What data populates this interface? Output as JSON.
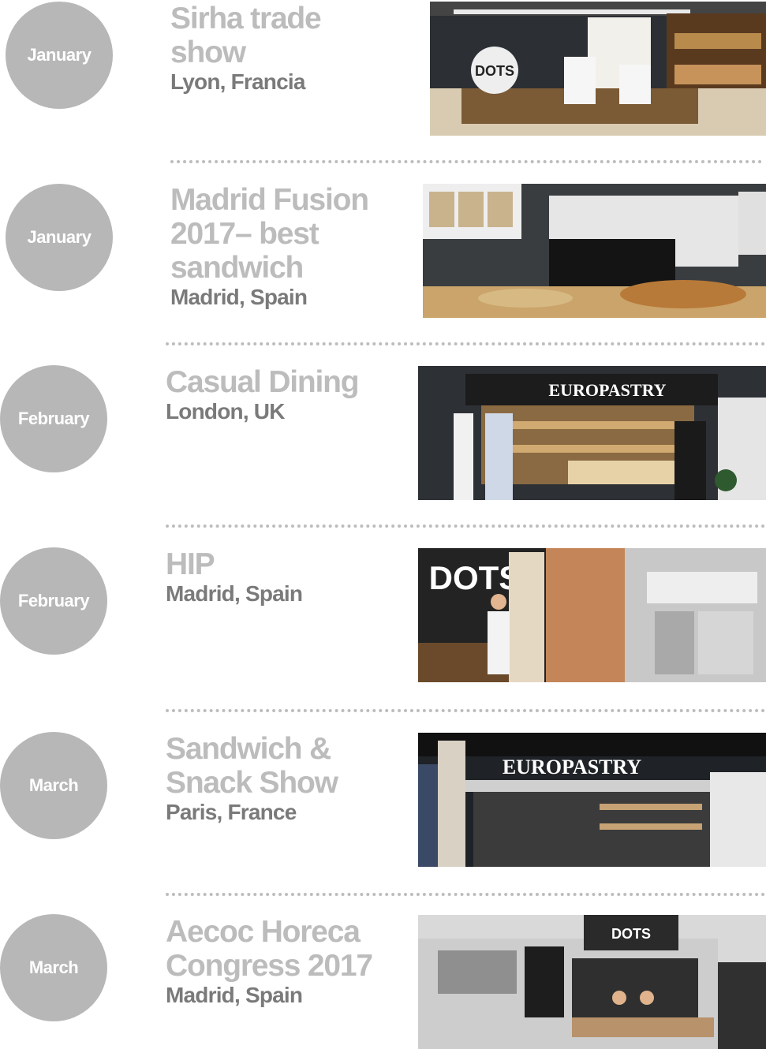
{
  "events": [
    {
      "month": "January",
      "title": "Sirha trade show",
      "place": "Lyon, Francia",
      "photo_icon": "trade-show-booth-photo",
      "sign": "DOTS"
    },
    {
      "month": "January",
      "title": "Madrid Fusion 2017– best sandwich",
      "place": "Madrid, Spain",
      "photo_icon": "sandwich-booth-photo"
    },
    {
      "month": "February",
      "title": "Casual Dining",
      "place": "London, UK",
      "photo_icon": "bakery-stand-photo",
      "sign": "EUROPASTRY"
    },
    {
      "month": "February",
      "title": "HIP",
      "place": "Madrid, Spain",
      "photo_icon": "dots-stand-van-photo",
      "sign": "DOTS"
    },
    {
      "month": "March",
      "title": "Sandwich & Snack Show",
      "place": "Paris, France",
      "photo_icon": "europastry-booth-photo",
      "sign": "EUROPASTRY"
    },
    {
      "month": "March",
      "title": "Aecoc Horeca Congress  2017",
      "place": "Madrid, Spain",
      "photo_icon": "food-truck-photo",
      "sign": "DOTS"
    }
  ],
  "colors": {
    "circle": "#b7b7b7",
    "title": "#bcbcbc",
    "place": "#7a7a7a",
    "divider": "#bdbdbd"
  }
}
